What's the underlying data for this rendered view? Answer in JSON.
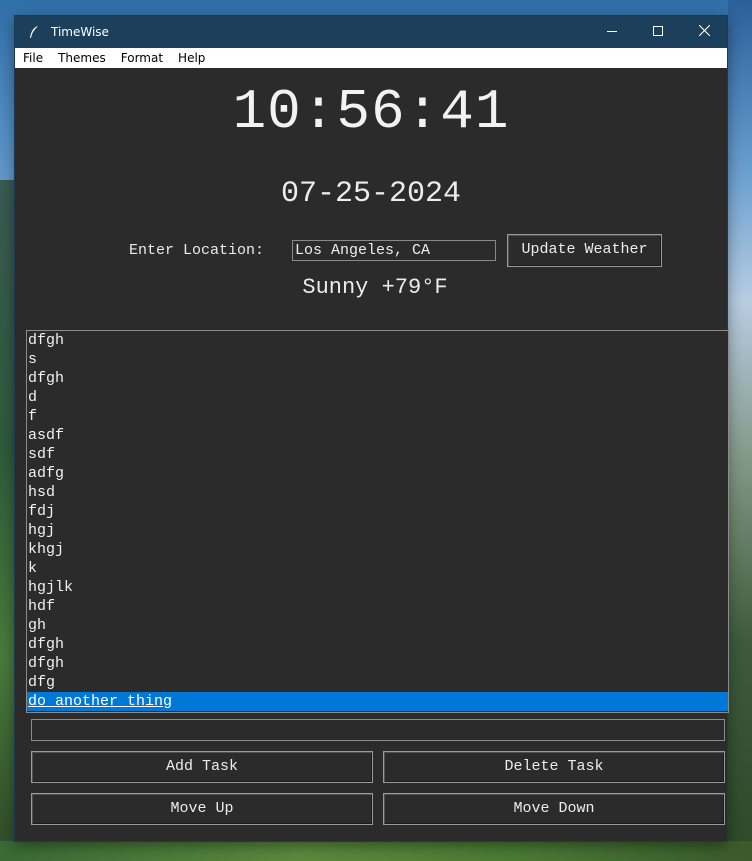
{
  "window": {
    "title": "TimeWise",
    "app_icon": "feather-icon"
  },
  "titlebar_buttons": [
    "minimize-icon",
    "maximize-icon",
    "close-icon"
  ],
  "menu": [
    "File",
    "Themes",
    "Format",
    "Help"
  ],
  "clock": {
    "time": "10:56:41",
    "date": "07-25-2024"
  },
  "location": {
    "label": "Enter Location:",
    "value": "Los Angeles, CA"
  },
  "weather": {
    "button": "Update Weather",
    "current": "Sunny +79°F"
  },
  "tasks": {
    "items": [
      "dfgh",
      "s",
      "dfgh",
      "d",
      "f",
      "asdf",
      "sdf",
      "adfg",
      "hsd",
      "fdj",
      "hgj",
      "khgj",
      "k",
      "hgjlk",
      "hdf",
      "gh",
      "dfgh",
      "dfgh",
      "dfg",
      "do another thing"
    ],
    "selected_index": 19,
    "new_task_value": ""
  },
  "buttons": {
    "add": "Add Task",
    "delete": "Delete Task",
    "move_up": "Move Up",
    "move_down": "Move Down"
  },
  "colors": {
    "window_bg": "#2b2b2b",
    "titlebar": "#1c3f5c",
    "selection": "#0078d7",
    "text": "#f0f0f0"
  }
}
